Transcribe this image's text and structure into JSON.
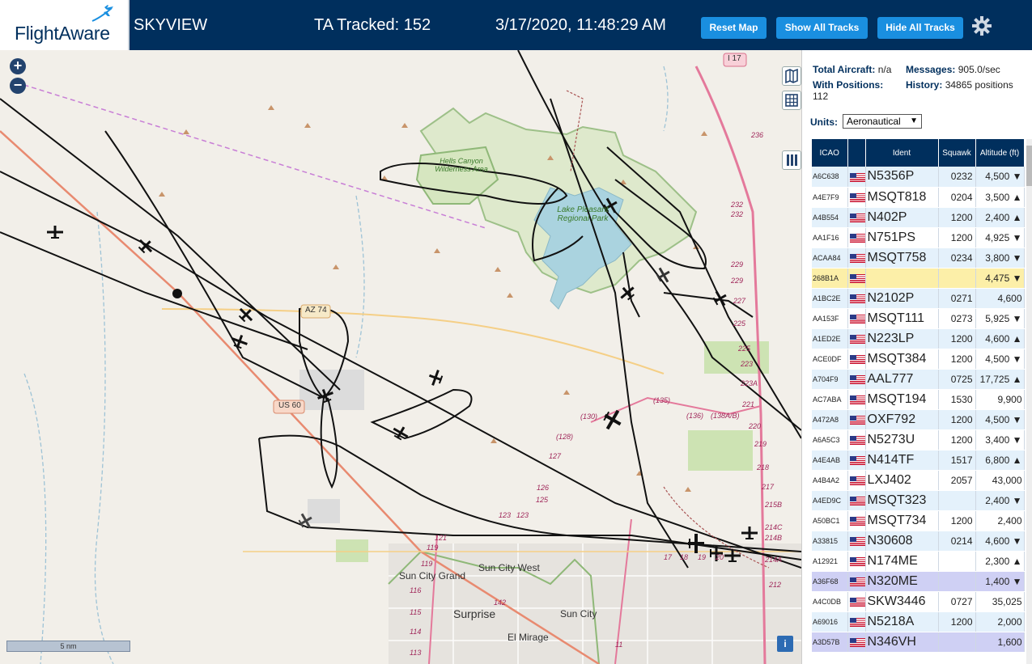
{
  "header": {
    "logo": "FlightAware",
    "app_title": "SKYVIEW",
    "tracked": "TA Tracked: 152",
    "datetime": "3/17/2020, 11:48:29 AM",
    "reset_map_label": "Reset Map",
    "show_all_label": "Show All Tracks",
    "hide_all_label": "Hide All Tracks"
  },
  "stats": {
    "total_aircraft_label": "Total Aircraft:",
    "total_aircraft_value": "n/a",
    "messages_label": "Messages:",
    "messages_value": "905.0/sec",
    "with_positions_label": "With Positions:",
    "with_positions_value": "112",
    "history_label": "History:",
    "history_value": "34865 positions",
    "units_label": "Units:",
    "units_value": "Aeronautical"
  },
  "table": {
    "headers": {
      "icao": "ICAO",
      "ident": "Ident",
      "squawk": "Squawk",
      "altitude": "Altitude (ft)"
    },
    "rows": [
      {
        "icao": "A6C638",
        "ident": "N5356P",
        "squawk": "0232",
        "alt": "4,500 ▼",
        "style": ""
      },
      {
        "icao": "A4E7F9",
        "ident": "MSQT818",
        "squawk": "0204",
        "alt": "3,500 ▲",
        "style": "alt"
      },
      {
        "icao": "A4B554",
        "ident": "N402P",
        "squawk": "1200",
        "alt": "2,400 ▲",
        "style": ""
      },
      {
        "icao": "AA1F16",
        "ident": "N751PS",
        "squawk": "1200",
        "alt": "4,925 ▼",
        "style": "alt"
      },
      {
        "icao": "ACAA84",
        "ident": "MSQT758",
        "squawk": "0234",
        "alt": "3,800 ▼",
        "style": ""
      },
      {
        "icao": "268B1A",
        "ident": "",
        "squawk": "",
        "alt": "4,475 ▼",
        "style": "hl-yellow"
      },
      {
        "icao": "A1BC2E",
        "ident": "N2102P",
        "squawk": "0271",
        "alt": "4,600",
        "style": ""
      },
      {
        "icao": "AA153F",
        "ident": "MSQT111",
        "squawk": "0273",
        "alt": "5,925 ▼",
        "style": "alt"
      },
      {
        "icao": "A1ED2E",
        "ident": "N223LP",
        "squawk": "1200",
        "alt": "4,600 ▲",
        "style": ""
      },
      {
        "icao": "ACE0DF",
        "ident": "MSQT384",
        "squawk": "1200",
        "alt": "4,500 ▼",
        "style": "alt"
      },
      {
        "icao": "A704F9",
        "ident": "AAL777",
        "squawk": "0725",
        "alt": "17,725 ▲",
        "style": ""
      },
      {
        "icao": "AC7ABA",
        "ident": "MSQT194",
        "squawk": "1530",
        "alt": "9,900",
        "style": "alt"
      },
      {
        "icao": "A472A8",
        "ident": "OXF792",
        "squawk": "1200",
        "alt": "4,500 ▼",
        "style": ""
      },
      {
        "icao": "A6A5C3",
        "ident": "N5273U",
        "squawk": "1200",
        "alt": "3,400 ▼",
        "style": "alt"
      },
      {
        "icao": "A4E4AB",
        "ident": "N414TF",
        "squawk": "1517",
        "alt": "6,800 ▲",
        "style": ""
      },
      {
        "icao": "A4B4A2",
        "ident": "LXJ402",
        "squawk": "2057",
        "alt": "43,000",
        "style": "alt"
      },
      {
        "icao": "A4ED9C",
        "ident": "MSQT323",
        "squawk": "",
        "alt": "2,400 ▼",
        "style": ""
      },
      {
        "icao": "A50BC1",
        "ident": "MSQT734",
        "squawk": "1200",
        "alt": "2,400",
        "style": "alt"
      },
      {
        "icao": "A33815",
        "ident": "N30608",
        "squawk": "0214",
        "alt": "4,600 ▼",
        "style": ""
      },
      {
        "icao": "A12921",
        "ident": "N174ME",
        "squawk": "",
        "alt": "2,300 ▲",
        "style": "alt"
      },
      {
        "icao": "A36F68",
        "ident": "N320ME",
        "squawk": "",
        "alt": "1,400 ▼",
        "style": "hl-purple"
      },
      {
        "icao": "A4C0DB",
        "ident": "SKW3446",
        "squawk": "0727",
        "alt": "35,025",
        "style": "alt"
      },
      {
        "icao": "A69016",
        "ident": "N5218A",
        "squawk": "1200",
        "alt": "2,000",
        "style": ""
      },
      {
        "icao": "A3D57B",
        "ident": "N346VH",
        "squawk": "",
        "alt": "1,600",
        "style": "hl-purple"
      }
    ]
  },
  "map": {
    "labels": {
      "hells_canyon": "Hells Canyon Wilderness Area",
      "lake_pleasant": "Lake Pleasant Regional Park",
      "sun_city_grand": "Sun City Grand",
      "sun_city_west": "Sun City West",
      "surprise": "Surprise",
      "sun_city": "Sun City",
      "el_mirage": "El Mirage",
      "az74": "AZ 74",
      "us60": "US 60",
      "i17": "I 17"
    },
    "scale": "5 nm",
    "info": "i",
    "route_numbers": [
      "236",
      "232",
      "232",
      "229",
      "229",
      "227",
      "225",
      "225",
      "223",
      "223A",
      "221",
      "220",
      "219",
      "218",
      "217",
      "215B",
      "214C",
      "214B",
      "214A",
      "212",
      "(135)",
      "(136)",
      "(138A/B)",
      "(130)",
      "(128)",
      "127",
      "126",
      "125",
      "123",
      "123",
      "121",
      "119",
      "119",
      "116",
      "115",
      "114",
      "113",
      "142",
      "17",
      "18",
      "19",
      "20",
      "11",
      "(130)"
    ]
  }
}
